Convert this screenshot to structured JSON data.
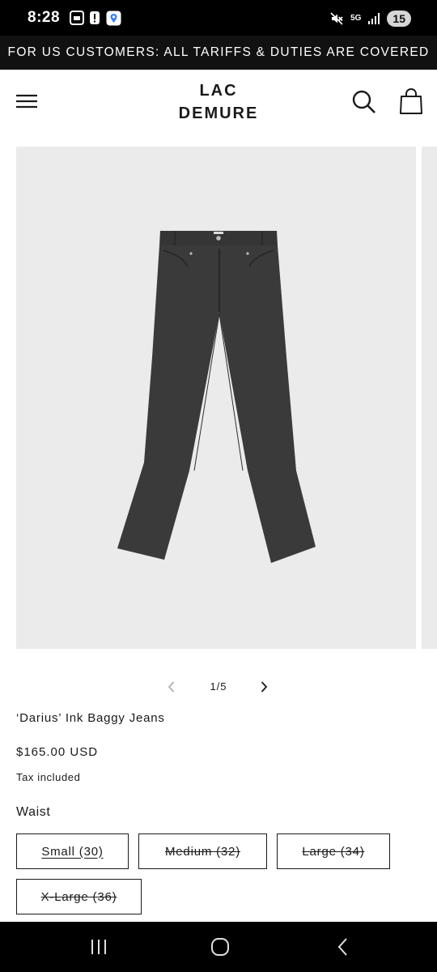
{
  "status_bar": {
    "time": "8:28",
    "network": "5G",
    "battery": "15"
  },
  "announcement": {
    "text": "FOR US CUSTOMERS: ALL TARIFFS & DUTIES ARE COVERED"
  },
  "header": {
    "logo_line1": "LAC",
    "logo_line2": "DEMURE"
  },
  "gallery": {
    "counter": "1/5",
    "image_background": "#ebebeb",
    "jeans_color": "#3a3a3a"
  },
  "product": {
    "title": "‘Darius’ Ink Baggy Jeans",
    "price": "$165.00 USD",
    "tax_note": "Tax included",
    "variant_label": "Waist",
    "sizes": [
      {
        "label": "Small (30)",
        "state": "selected"
      },
      {
        "label": "Medium (32)",
        "state": "sold-out"
      },
      {
        "label": "Large (34)",
        "state": "sold-out"
      },
      {
        "label": "X-Large (36)",
        "state": "sold-out"
      }
    ]
  },
  "icons": {
    "status": [
      "gallery-icon",
      "alert-icon",
      "maps-icon",
      "mute-icon",
      "signal-icon"
    ],
    "header": [
      "menu-icon",
      "search-icon",
      "cart-icon"
    ],
    "slider": [
      "chevron-left-icon",
      "chevron-right-icon"
    ],
    "nav": [
      "recent-apps-icon",
      "home-icon",
      "back-icon"
    ]
  }
}
